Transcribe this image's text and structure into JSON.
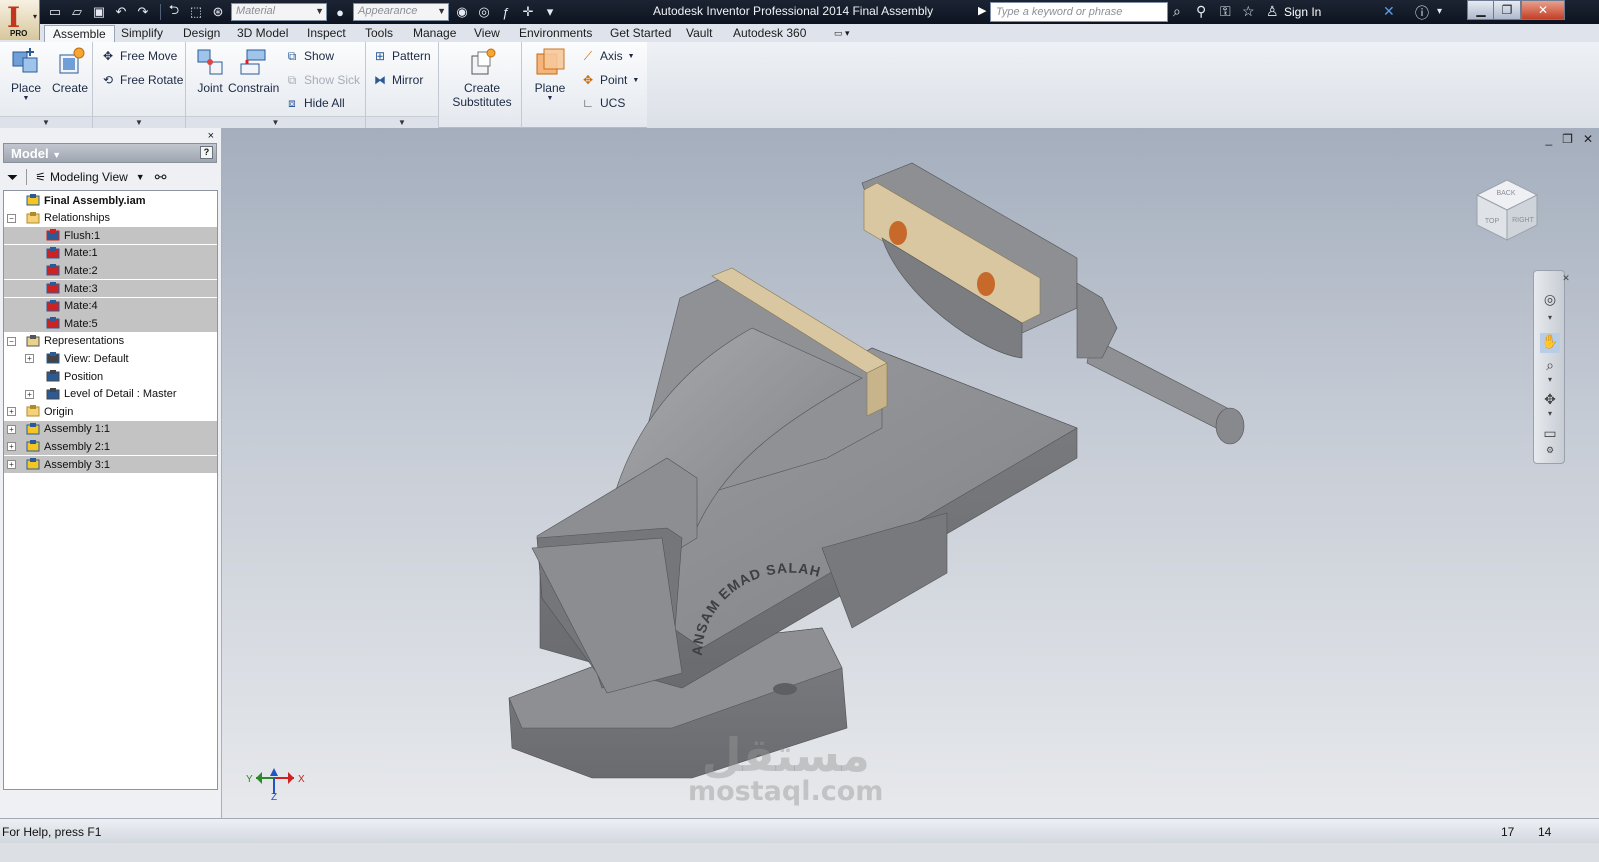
{
  "app": {
    "window_title": "Autodesk Inventor Professional 2014    Final Assembly",
    "badge": "PRO",
    "letter": "I"
  },
  "quick_access": {
    "material_placeholder": "Material",
    "appearance_placeholder": "Appearance",
    "search_placeholder": "Type a keyword or phrase",
    "sign_in": "Sign In"
  },
  "tabs": [
    {
      "label": "Assemble",
      "active": true
    },
    {
      "label": "Simplify"
    },
    {
      "label": "Design"
    },
    {
      "label": "3D Model"
    },
    {
      "label": "Inspect"
    },
    {
      "label": "Tools"
    },
    {
      "label": "Manage"
    },
    {
      "label": "View"
    },
    {
      "label": "Environments"
    },
    {
      "label": "Get Started"
    },
    {
      "label": "Vault"
    },
    {
      "label": "Autodesk 360"
    }
  ],
  "ribbon": {
    "place": "Place",
    "create": "Create",
    "free_move": "Free Move",
    "free_rotate": "Free Rotate",
    "joint": "Joint",
    "constrain": "Constrain",
    "show": "Show",
    "show_sick": "Show Sick",
    "hide_all": "Hide All",
    "pattern": "Pattern",
    "mirror": "Mirror",
    "create_substitutes_1": "Create",
    "create_substitutes_2": "Substitutes",
    "plane": "Plane",
    "axis": "Axis",
    "point": "Point",
    "ucs": "UCS"
  },
  "browser": {
    "title": "Model",
    "view_mode": "Modeling View",
    "close": "×",
    "help": "?",
    "tree": [
      {
        "label": "Final Assembly.iam",
        "depth": 0,
        "bold": true,
        "icon": "assembly-icon"
      },
      {
        "label": "Relationships",
        "depth": 0,
        "expander": "−",
        "icon": "folder-icon"
      },
      {
        "label": "Flush:1",
        "depth": 1,
        "sel": true,
        "icon": "flush-constraint-icon"
      },
      {
        "label": "Mate:1",
        "depth": 1,
        "sel": true,
        "icon": "mate-constraint-icon"
      },
      {
        "label": "Mate:2",
        "depth": 1,
        "sel": true,
        "icon": "mate-constraint-icon"
      },
      {
        "label": "Mate:3",
        "depth": 1,
        "sel": true,
        "icon": "mate-constraint-icon"
      },
      {
        "label": "Mate:4",
        "depth": 1,
        "sel": true,
        "icon": "mate-constraint-icon"
      },
      {
        "label": "Mate:5",
        "depth": 1,
        "sel": true,
        "icon": "mate-constraint-icon"
      },
      {
        "label": "Representations",
        "depth": 0,
        "expander": "−",
        "icon": "representations-icon"
      },
      {
        "label": "View: Default",
        "depth": 1,
        "expander": "+",
        "icon": "view-rep-icon"
      },
      {
        "label": "Position",
        "depth": 1,
        "icon": "position-rep-icon"
      },
      {
        "label": "Level of Detail : Master",
        "depth": 1,
        "expander": "+",
        "icon": "lod-icon"
      },
      {
        "label": "Origin",
        "depth": 0,
        "expander": "+",
        "icon": "folder-icon"
      },
      {
        "label": "Assembly 1:1",
        "depth": 0,
        "expander": "+",
        "sel": true,
        "icon": "subassembly-icon"
      },
      {
        "label": "Assembly 2:1",
        "depth": 0,
        "expander": "+",
        "sel": true,
        "icon": "subassembly-icon"
      },
      {
        "label": "Assembly 3:1",
        "depth": 0,
        "expander": "+",
        "sel": true,
        "icon": "subassembly-icon"
      }
    ]
  },
  "viewport": {
    "engraving": "ANSAM EMAD SALAH",
    "viewcube_top": "TOP",
    "viewcube_back": "BACK",
    "viewcube_right": "RIGHT",
    "triad_x": "X",
    "triad_y": "Y",
    "triad_z": "Z",
    "watermark_ar": "مستقل",
    "watermark_en": "mostaql.com"
  },
  "status": {
    "help": "For Help, press F1",
    "count_a": "17",
    "count_b": "14"
  }
}
